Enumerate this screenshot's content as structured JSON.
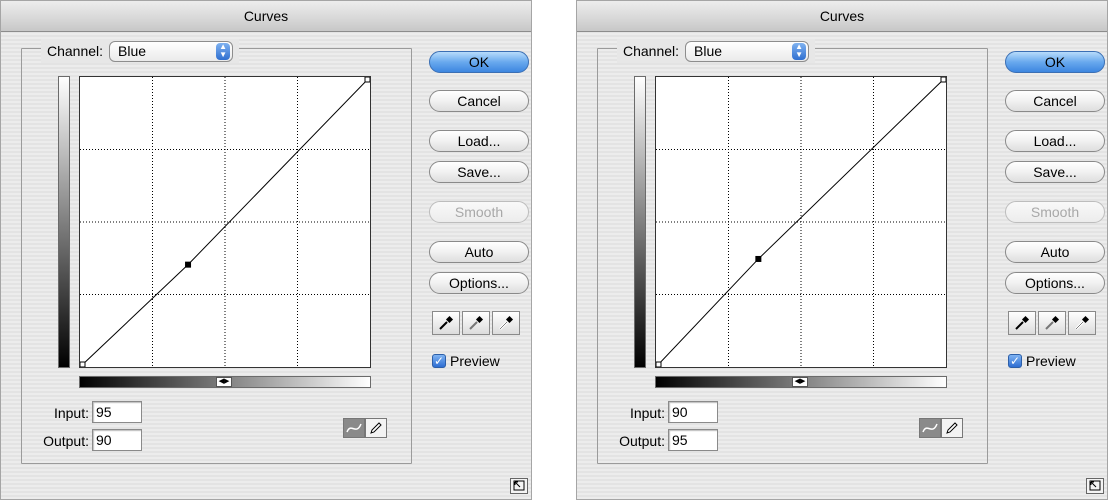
{
  "dialogs": [
    {
      "title": "Curves",
      "channel_label": "Channel:",
      "channel_value": "Blue",
      "input_label": "Input:",
      "input_value": "95",
      "output_label": "Output:",
      "output_value": "90",
      "control_point": {
        "input": 95,
        "output": 90
      },
      "buttons": {
        "ok": "OK",
        "cancel": "Cancel",
        "load": "Load...",
        "save": "Save...",
        "smooth": "Smooth",
        "auto": "Auto",
        "options": "Options..."
      },
      "preview_label": "Preview",
      "preview_checked": true
    },
    {
      "title": "Curves",
      "channel_label": "Channel:",
      "channel_value": "Blue",
      "input_label": "Input:",
      "input_value": "90",
      "output_label": "Output:",
      "output_value": "95",
      "control_point": {
        "input": 90,
        "output": 95
      },
      "buttons": {
        "ok": "OK",
        "cancel": "Cancel",
        "load": "Load...",
        "save": "Save...",
        "smooth": "Smooth",
        "auto": "Auto",
        "options": "Options..."
      },
      "preview_label": "Preview",
      "preview_checked": true
    }
  ],
  "colors": {
    "ok_button": "#5b9ee9",
    "checkbox": "#3d7ed9",
    "curve": "#000000",
    "grid": "#000000"
  },
  "icons": [
    "select-arrows-icon",
    "hramp-arrows-icon",
    "curve-tool-icon",
    "pencil-tool-icon",
    "black-eyedropper-icon",
    "gray-eyedropper-icon",
    "white-eyedropper-icon",
    "checkmark-icon",
    "expand-window-icon"
  ]
}
